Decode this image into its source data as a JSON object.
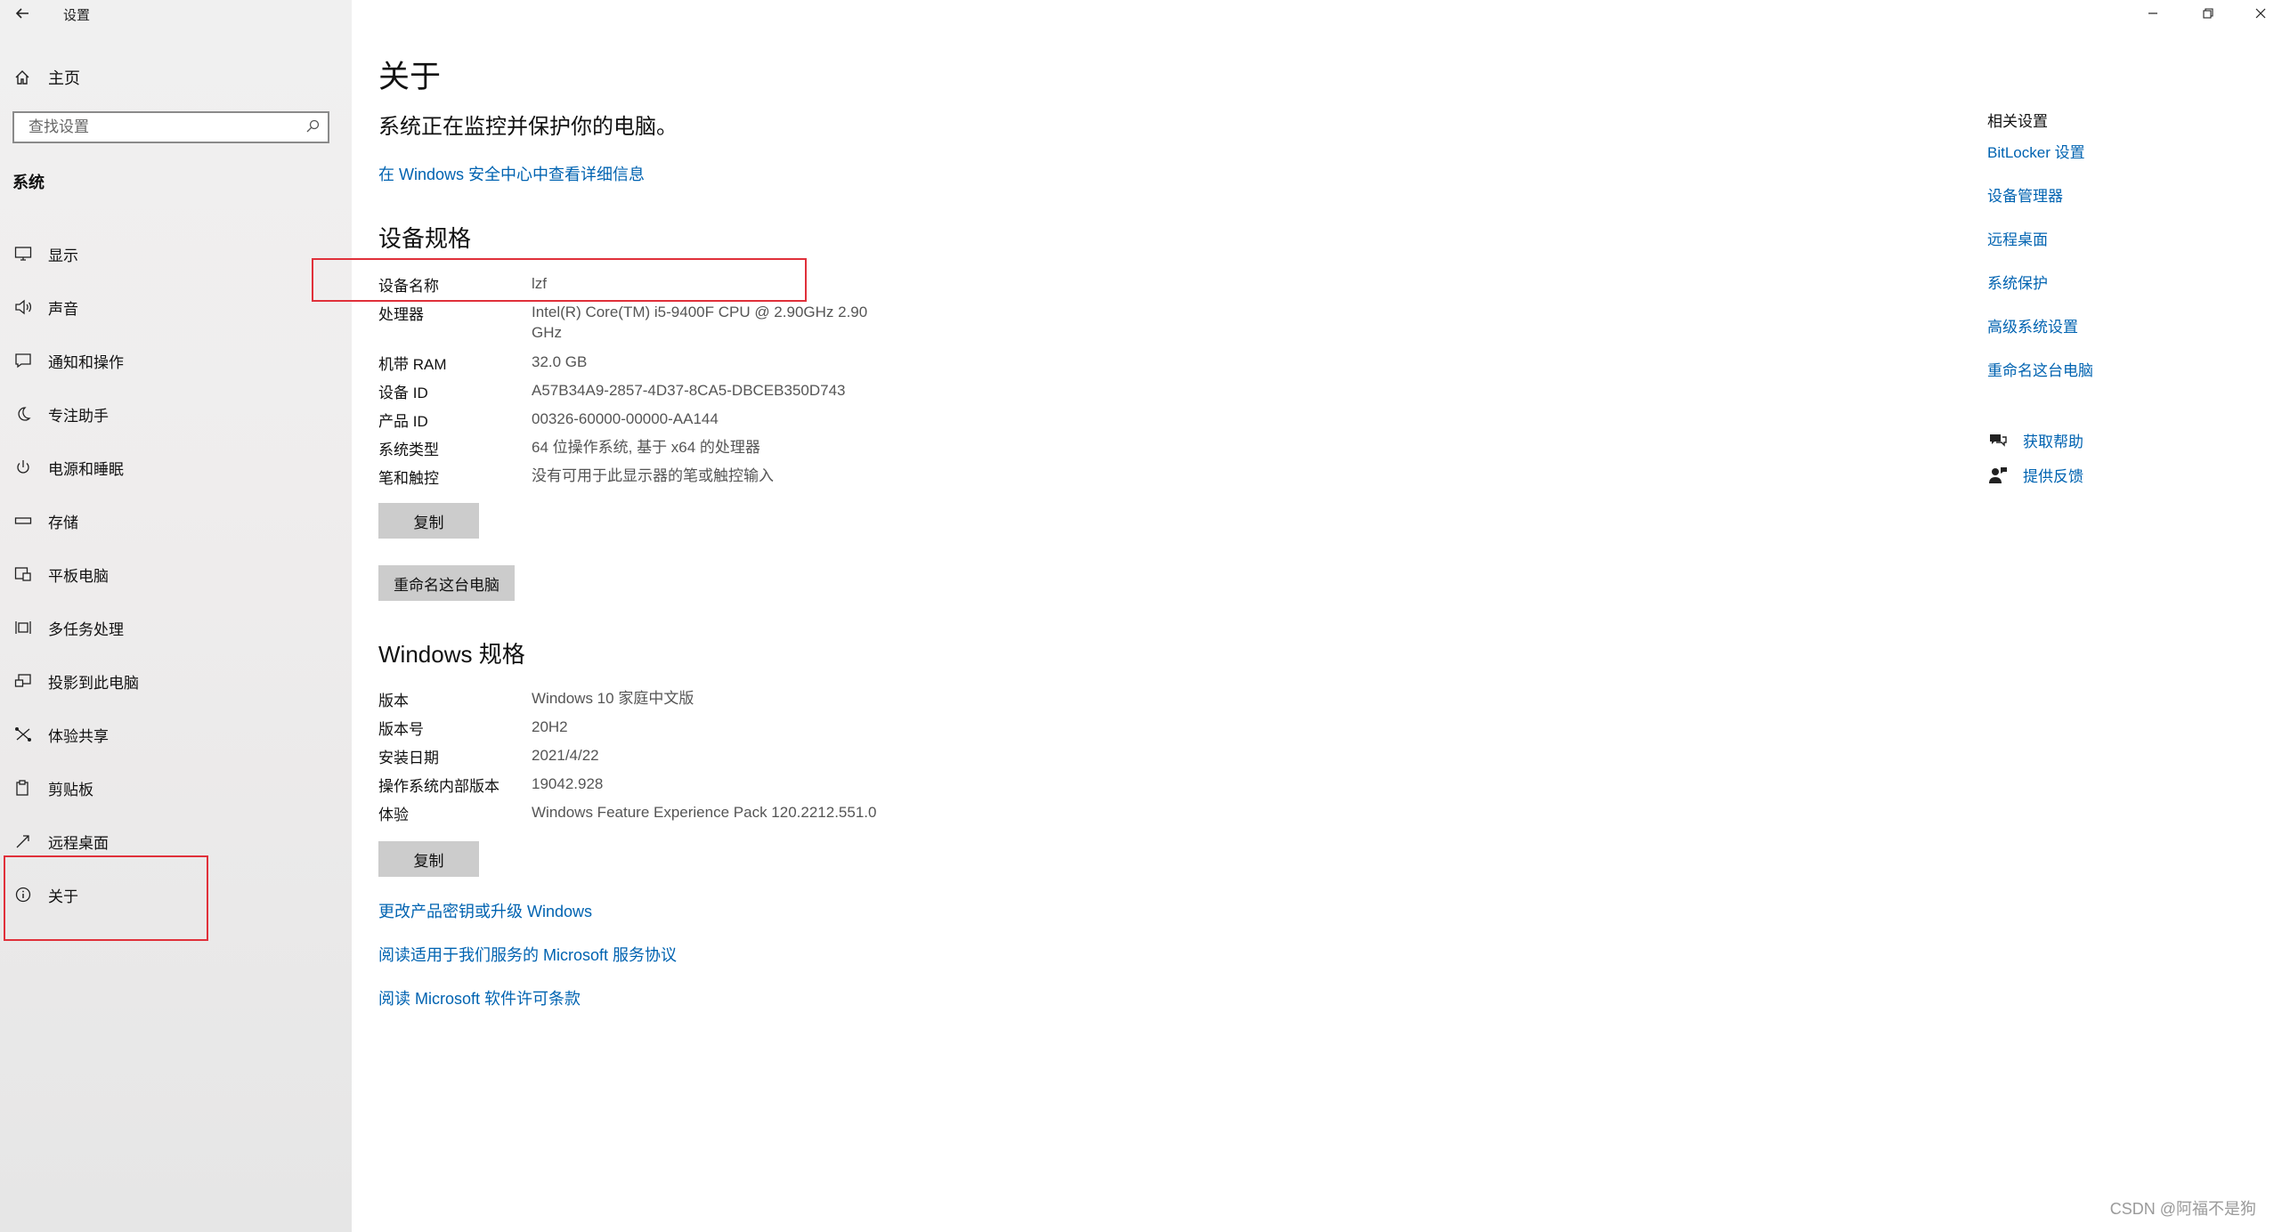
{
  "window": {
    "title": "设置",
    "back_icon": "arrow-left-icon"
  },
  "sidebar": {
    "home_label": "主页",
    "search_placeholder": "查找设置",
    "section": "系统",
    "items": [
      {
        "label": "显示",
        "icon": "display-icon"
      },
      {
        "label": "声音",
        "icon": "speaker-icon"
      },
      {
        "label": "通知和操作",
        "icon": "notification-icon"
      },
      {
        "label": "专注助手",
        "icon": "moon-icon"
      },
      {
        "label": "电源和睡眠",
        "icon": "power-icon"
      },
      {
        "label": "存储",
        "icon": "storage-icon"
      },
      {
        "label": "平板电脑",
        "icon": "tablet-icon"
      },
      {
        "label": "多任务处理",
        "icon": "multitask-icon"
      },
      {
        "label": "投影到此电脑",
        "icon": "project-icon"
      },
      {
        "label": "体验共享",
        "icon": "share-icon"
      },
      {
        "label": "剪贴板",
        "icon": "clipboard-icon"
      },
      {
        "label": "远程桌面",
        "icon": "remote-icon"
      },
      {
        "label": "关于",
        "icon": "info-icon"
      }
    ],
    "selected": "关于"
  },
  "main": {
    "title": "关于",
    "subtitle": "系统正在监控并保护你的电脑。",
    "security_link": "在 Windows 安全中心中查看详细信息",
    "device_specs": {
      "heading": "设备规格",
      "rows": [
        {
          "k": "设备名称",
          "v": "lzf"
        },
        {
          "k": "处理器",
          "v": "Intel(R) Core(TM) i5-9400F CPU @ 2.90GHz   2.90 GHz"
        },
        {
          "k": "机带 RAM",
          "v": "32.0 GB"
        },
        {
          "k": "设备 ID",
          "v": "A57B34A9-2857-4D37-8CA5-DBCEB350D743"
        },
        {
          "k": "产品 ID",
          "v": "00326-60000-00000-AA144"
        },
        {
          "k": "系统类型",
          "v": "64 位操作系统, 基于 x64 的处理器"
        },
        {
          "k": "笔和触控",
          "v": "没有可用于此显示器的笔或触控输入"
        }
      ],
      "copy_button": "复制",
      "rename_button": "重命名这台电脑"
    },
    "windows_specs": {
      "heading": "Windows 规格",
      "rows": [
        {
          "k": "版本",
          "v": "Windows 10 家庭中文版"
        },
        {
          "k": "版本号",
          "v": "20H2"
        },
        {
          "k": "安装日期",
          "v": "2021/4/22"
        },
        {
          "k": "操作系统内部版本",
          "v": "19042.928"
        },
        {
          "k": "体验",
          "v": "Windows Feature Experience Pack 120.2212.551.0"
        }
      ],
      "copy_button": "复制"
    },
    "links": [
      "更改产品密钥或升级 Windows",
      "阅读适用于我们服务的 Microsoft 服务协议",
      "阅读 Microsoft 软件许可条款"
    ]
  },
  "related": {
    "title": "相关设置",
    "links": [
      "BitLocker 设置",
      "设备管理器",
      "远程桌面",
      "系统保护",
      "高级系统设置",
      "重命名这台电脑"
    ],
    "help": [
      {
        "label": "获取帮助",
        "icon": "help-chat-icon"
      },
      {
        "label": "提供反馈",
        "icon": "feedback-icon"
      }
    ]
  },
  "watermark": "CSDN @阿福不是狗",
  "colors": {
    "accent_link": "#0063b1",
    "highlight_box": "#e0303a",
    "button_bg": "#cccccc"
  }
}
